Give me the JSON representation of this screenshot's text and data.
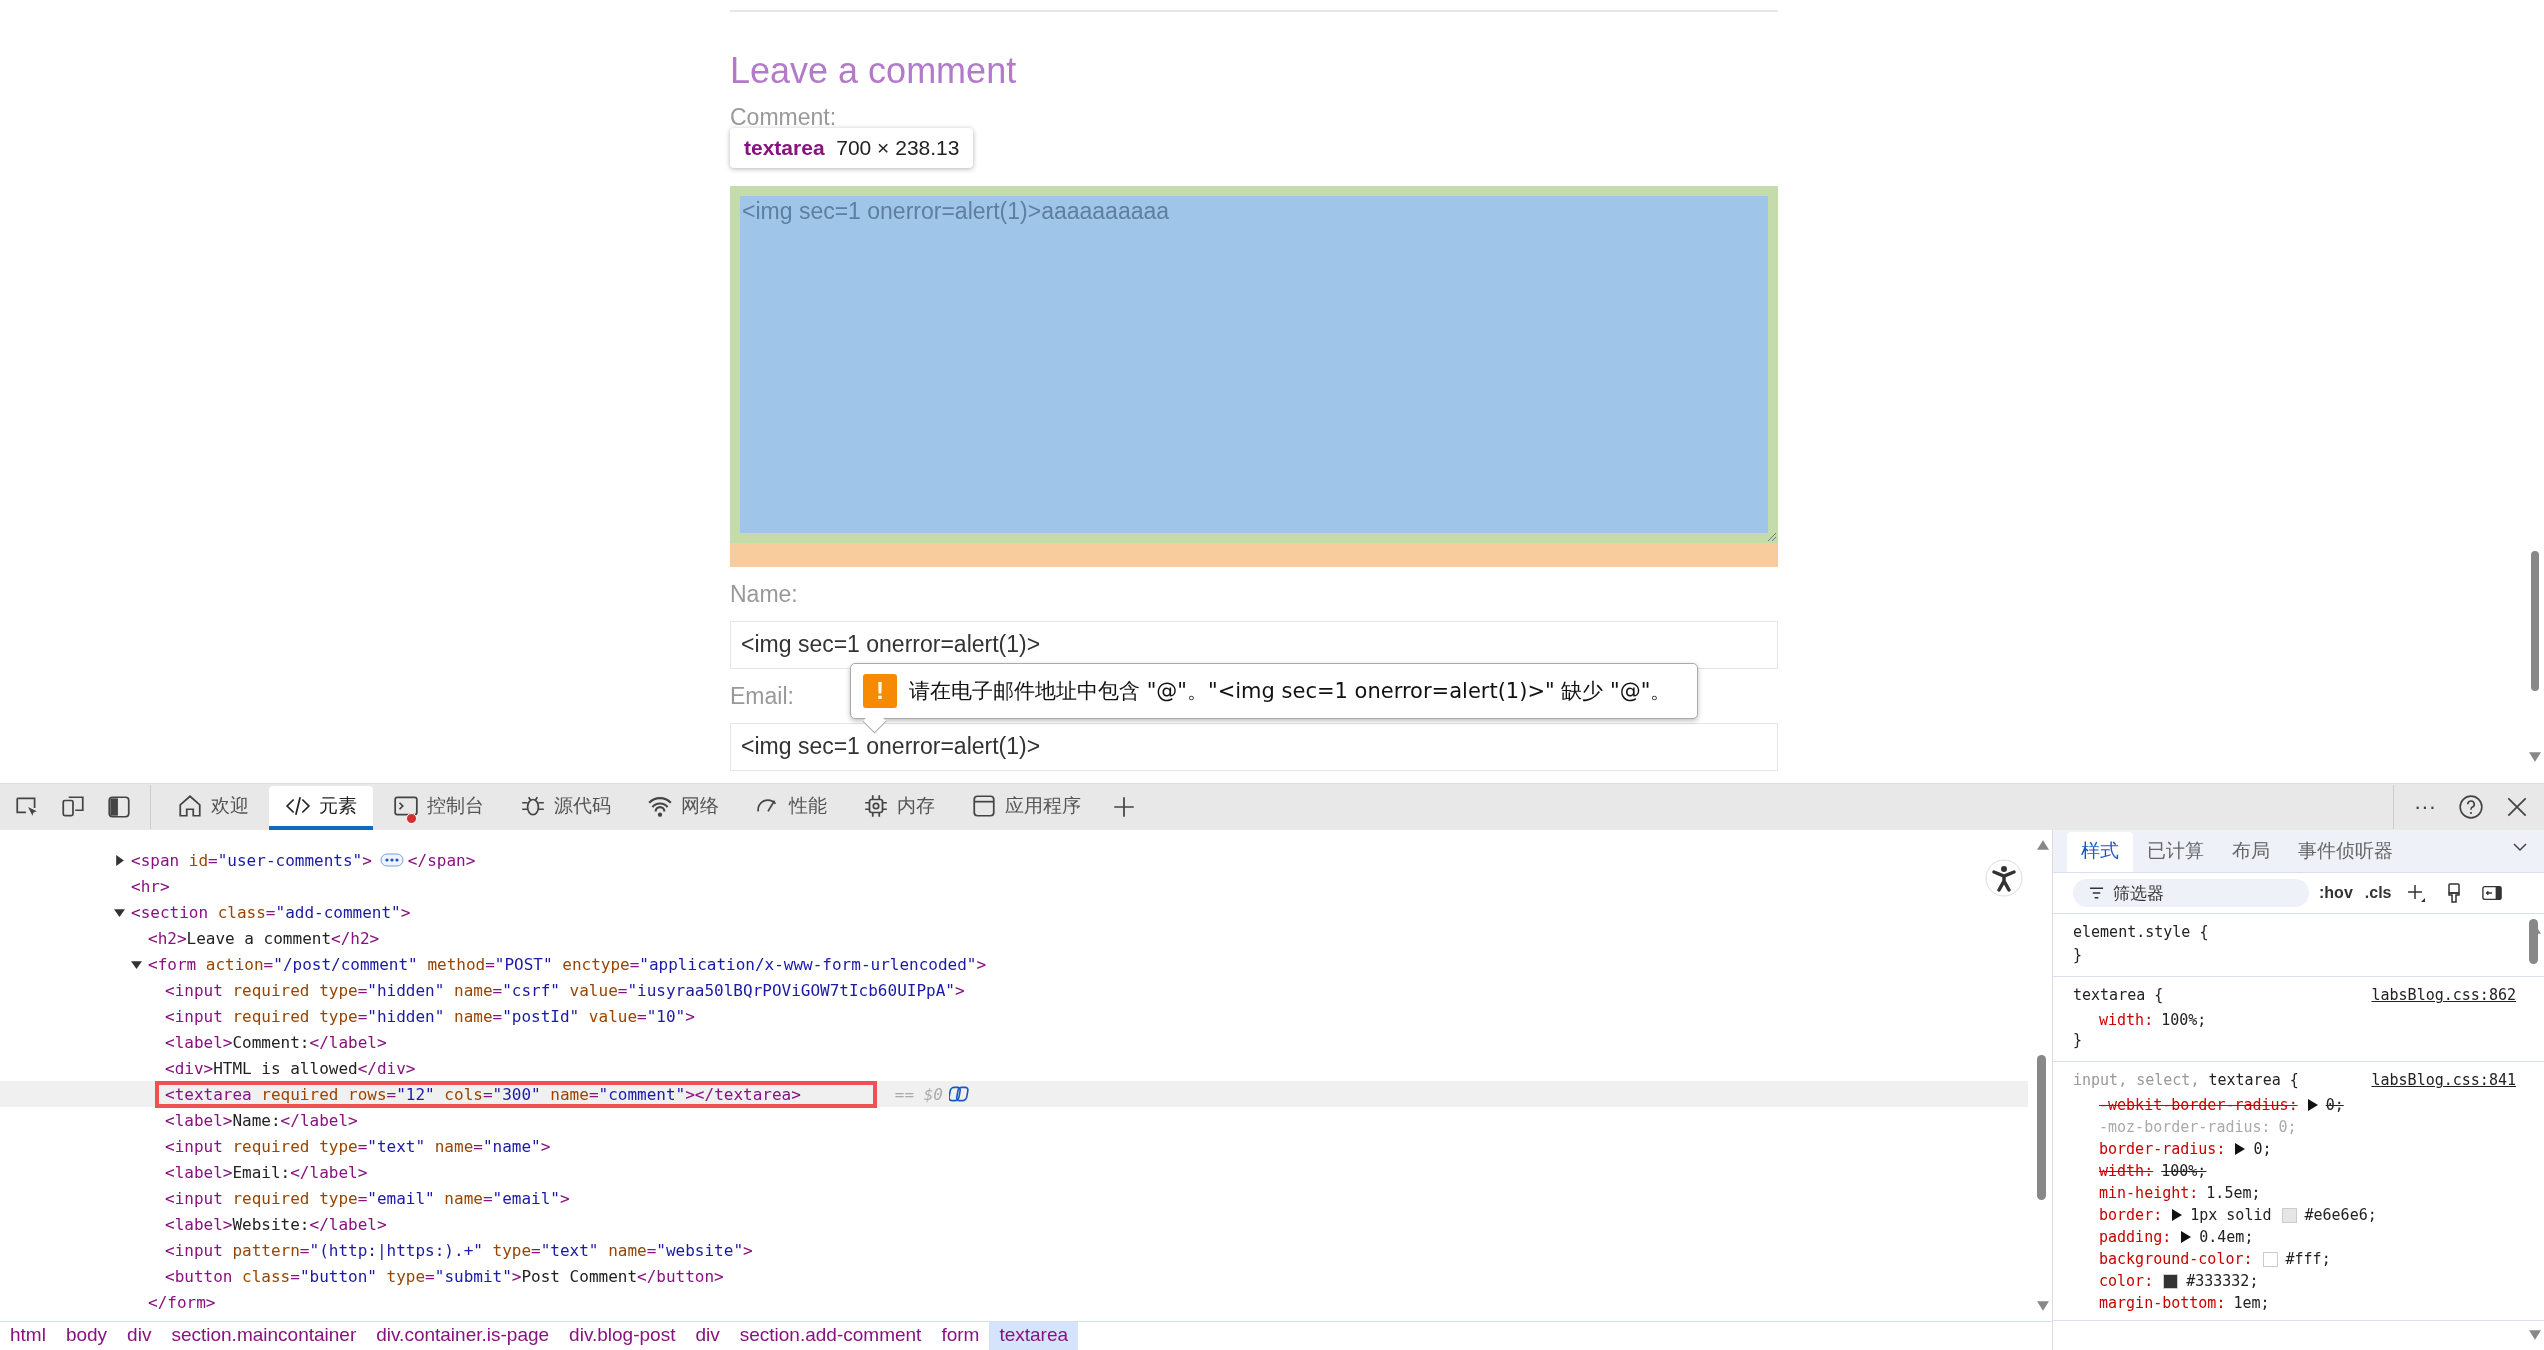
{
  "page": {
    "heading": "Leave a comment",
    "comment_label": "Comment:",
    "inspect_tooltip": {
      "tag": "textarea",
      "size": "700 × 238.13"
    },
    "comment_value": "<img sec=1 onerror=alert(1)>aaaaaaaaaa",
    "fields": [
      {
        "label": "Name:",
        "value": "<img sec=1 onerror=alert(1)>"
      },
      {
        "label": "Email:",
        "value": "<img sec=1 onerror=alert(1)>"
      }
    ],
    "validation": {
      "icon": "!",
      "message": "请在电子邮件地址中包含 \"@\"。\"<img sec=1 onerror=alert(1)>\" 缺少 \"@\"。"
    }
  },
  "devtools": {
    "tabs": [
      {
        "label": "欢迎",
        "selected": false
      },
      {
        "label": "元素",
        "selected": true
      },
      {
        "label": "控制台",
        "selected": false,
        "has_errors": true
      },
      {
        "label": "源代码",
        "selected": false
      },
      {
        "label": "网络",
        "selected": false
      },
      {
        "label": "性能",
        "selected": false
      },
      {
        "label": "内存",
        "selected": false
      },
      {
        "label": "应用程序",
        "selected": false
      }
    ],
    "more_icon": "···",
    "nodes": [
      {
        "selected": false,
        "expanded": false,
        "tokens": [
          {
            "kind": "tag",
            "s": "<span"
          },
          {
            "kind": "attr",
            "s": " id"
          },
          {
            "kind": "tag",
            "s": "="
          },
          {
            "kind": "value",
            "s": "\"user-comments\""
          },
          {
            "kind": "tag",
            "s": ">"
          }
        ],
        "tail": [
          {
            "kind": "tag",
            "s": "</span>"
          }
        ]
      },
      {
        "selected": false,
        "tokens": [
          {
            "kind": "tag",
            "s": "<hr>"
          }
        ]
      },
      {
        "selected": false,
        "expanded": true,
        "tokens": [
          {
            "kind": "tag",
            "s": "<section"
          },
          {
            "kind": "attr",
            "s": " class"
          },
          {
            "kind": "tag",
            "s": "="
          },
          {
            "kind": "value",
            "s": "\"add-comment\""
          },
          {
            "kind": "tag",
            "s": ">"
          }
        ],
        "children": [
          {
            "selected": false,
            "tokens": [
              {
                "kind": "tag",
                "s": "<h2>"
              },
              {
                "kind": "text",
                "s": "Leave a comment"
              },
              {
                "kind": "tag",
                "s": "</h2>"
              }
            ]
          },
          {
            "selected": false,
            "expanded": true,
            "tokens": [
              {
                "kind": "tag",
                "s": "<form"
              },
              {
                "kind": "attr",
                "s": " action"
              },
              {
                "kind": "tag",
                "s": "="
              },
              {
                "kind": "value",
                "s": "\"/post/comment\""
              },
              {
                "kind": "attr",
                "s": " method"
              },
              {
                "kind": "tag",
                "s": "="
              },
              {
                "kind": "value",
                "s": "\"POST\""
              },
              {
                "kind": "attr",
                "s": " enctype"
              },
              {
                "kind": "tag",
                "s": "="
              },
              {
                "kind": "value",
                "s": "\"application/x-www-form-urlencoded\""
              },
              {
                "kind": "tag",
                "s": ">"
              }
            ],
            "children": [
              {
                "selected": false,
                "tokens": [
                  {
                    "kind": "tag",
                    "s": "<input"
                  },
                  {
                    "kind": "attr",
                    "s": " required type"
                  },
                  {
                    "kind": "tag",
                    "s": "="
                  },
                  {
                    "kind": "value",
                    "s": "\"hidden\""
                  },
                  {
                    "kind": "attr",
                    "s": " name"
                  },
                  {
                    "kind": "tag",
                    "s": "="
                  },
                  {
                    "kind": "value",
                    "s": "\"csrf\""
                  },
                  {
                    "kind": "attr",
                    "s": " value"
                  },
                  {
                    "kind": "tag",
                    "s": "="
                  },
                  {
                    "kind": "value",
                    "s": "\"iusyraa50lBQrPOViGOW7tIcb60UIPpA\""
                  },
                  {
                    "kind": "tag",
                    "s": ">"
                  }
                ]
              },
              {
                "selected": false,
                "tokens": [
                  {
                    "kind": "tag",
                    "s": "<input"
                  },
                  {
                    "kind": "attr",
                    "s": " required type"
                  },
                  {
                    "kind": "tag",
                    "s": "="
                  },
                  {
                    "kind": "value",
                    "s": "\"hidden\""
                  },
                  {
                    "kind": "attr",
                    "s": " name"
                  },
                  {
                    "kind": "tag",
                    "s": "="
                  },
                  {
                    "kind": "value",
                    "s": "\"postId\""
                  },
                  {
                    "kind": "attr",
                    "s": " value"
                  },
                  {
                    "kind": "tag",
                    "s": "="
                  },
                  {
                    "kind": "value",
                    "s": "\"10\""
                  },
                  {
                    "kind": "tag",
                    "s": ">"
                  }
                ]
              },
              {
                "selected": false,
                "tokens": [
                  {
                    "kind": "tag",
                    "s": "<label>"
                  },
                  {
                    "kind": "text",
                    "s": "Comment:"
                  },
                  {
                    "kind": "tag",
                    "s": "</label>"
                  }
                ]
              },
              {
                "selected": false,
                "tokens": [
                  {
                    "kind": "tag",
                    "s": "<div>"
                  },
                  {
                    "kind": "text",
                    "s": "HTML is allowed"
                  },
                  {
                    "kind": "tag",
                    "s": "</div>"
                  }
                ]
              },
              {
                "selected": true,
                "marker": "== $0",
                "tokens": [
                  {
                    "kind": "tag",
                    "s": "<textarea"
                  },
                  {
                    "kind": "attr",
                    "s": " required rows"
                  },
                  {
                    "kind": "tag",
                    "s": "="
                  },
                  {
                    "kind": "value",
                    "s": "\"12\""
                  },
                  {
                    "kind": "attr",
                    "s": " cols"
                  },
                  {
                    "kind": "tag",
                    "s": "="
                  },
                  {
                    "kind": "value",
                    "s": "\"300\""
                  },
                  {
                    "kind": "attr",
                    "s": " name"
                  },
                  {
                    "kind": "tag",
                    "s": "="
                  },
                  {
                    "kind": "value",
                    "s": "\"comment\""
                  },
                  {
                    "kind": "tag",
                    "s": "></textarea>"
                  }
                ]
              },
              {
                "selected": false,
                "tokens": [
                  {
                    "kind": "tag",
                    "s": "<label>"
                  },
                  {
                    "kind": "text",
                    "s": "Name:"
                  },
                  {
                    "kind": "tag",
                    "s": "</label>"
                  }
                ]
              },
              {
                "selected": false,
                "tokens": [
                  {
                    "kind": "tag",
                    "s": "<input"
                  },
                  {
                    "kind": "attr",
                    "s": " required type"
                  },
                  {
                    "kind": "tag",
                    "s": "="
                  },
                  {
                    "kind": "value",
                    "s": "\"text\""
                  },
                  {
                    "kind": "attr",
                    "s": " name"
                  },
                  {
                    "kind": "tag",
                    "s": "="
                  },
                  {
                    "kind": "value",
                    "s": "\"name\""
                  },
                  {
                    "kind": "tag",
                    "s": ">"
                  }
                ]
              },
              {
                "selected": false,
                "tokens": [
                  {
                    "kind": "tag",
                    "s": "<label>"
                  },
                  {
                    "kind": "text",
                    "s": "Email:"
                  },
                  {
                    "kind": "tag",
                    "s": "</label>"
                  }
                ]
              },
              {
                "selected": false,
                "tokens": [
                  {
                    "kind": "tag",
                    "s": "<input"
                  },
                  {
                    "kind": "attr",
                    "s": " required type"
                  },
                  {
                    "kind": "tag",
                    "s": "="
                  },
                  {
                    "kind": "value",
                    "s": "\"email\""
                  },
                  {
                    "kind": "attr",
                    "s": " name"
                  },
                  {
                    "kind": "tag",
                    "s": "="
                  },
                  {
                    "kind": "value",
                    "s": "\"email\""
                  },
                  {
                    "kind": "tag",
                    "s": ">"
                  }
                ]
              },
              {
                "selected": false,
                "tokens": [
                  {
                    "kind": "tag",
                    "s": "<label>"
                  },
                  {
                    "kind": "text",
                    "s": "Website:"
                  },
                  {
                    "kind": "tag",
                    "s": "</label>"
                  }
                ]
              },
              {
                "selected": false,
                "tokens": [
                  {
                    "kind": "tag",
                    "s": "<input"
                  },
                  {
                    "kind": "attr",
                    "s": " pattern"
                  },
                  {
                    "kind": "tag",
                    "s": "="
                  },
                  {
                    "kind": "value",
                    "s": "\"(http:|https:).+\""
                  },
                  {
                    "kind": "attr",
                    "s": " type"
                  },
                  {
                    "kind": "tag",
                    "s": "="
                  },
                  {
                    "kind": "value",
                    "s": "\"text\""
                  },
                  {
                    "kind": "attr",
                    "s": " name"
                  },
                  {
                    "kind": "tag",
                    "s": "="
                  },
                  {
                    "kind": "value",
                    "s": "\"website\""
                  },
                  {
                    "kind": "tag",
                    "s": ">"
                  }
                ]
              },
              {
                "selected": false,
                "tokens": [
                  {
                    "kind": "tag",
                    "s": "<button"
                  },
                  {
                    "kind": "attr",
                    "s": " class"
                  },
                  {
                    "kind": "tag",
                    "s": "="
                  },
                  {
                    "kind": "value",
                    "s": "\"button\""
                  },
                  {
                    "kind": "attr",
                    "s": " type"
                  },
                  {
                    "kind": "tag",
                    "s": "="
                  },
                  {
                    "kind": "value",
                    "s": "\"submit\""
                  },
                  {
                    "kind": "tag",
                    "s": ">"
                  },
                  {
                    "kind": "text",
                    "s": "Post Comment"
                  },
                  {
                    "kind": "tag",
                    "s": "</button>"
                  }
                ]
              }
            ]
          },
          {
            "selected": false,
            "tokens": [
              {
                "kind": "tag",
                "s": "</form>"
              }
            ]
          }
        ]
      }
    ],
    "breadcrumbs": [
      {
        "label": "html",
        "selected": false
      },
      {
        "label": "body",
        "selected": false
      },
      {
        "label": "div",
        "selected": false
      },
      {
        "label": "section.maincontainer",
        "selected": false
      },
      {
        "label": "div.container.is-page",
        "selected": false
      },
      {
        "label": "div.blog-post",
        "selected": false
      },
      {
        "label": "div",
        "selected": false
      },
      {
        "label": "section.add-comment",
        "selected": false
      },
      {
        "label": "form",
        "selected": false
      },
      {
        "label": "textarea",
        "selected": true
      }
    ],
    "style_tabs": [
      {
        "label": "样式",
        "selected": true
      },
      {
        "label": "已计算",
        "selected": false
      },
      {
        "label": "布局",
        "selected": false
      },
      {
        "label": "事件侦听器",
        "selected": false
      }
    ],
    "filter": {
      "placeholder": "筛选器"
    },
    "style_buttons": [
      ":hov",
      ".cls"
    ],
    "rules": [
      {
        "selector": [
          {
            "s": "element.style {",
            "matched": true
          }
        ],
        "close": "}"
      },
      {
        "selector": [
          {
            "s": "textarea {",
            "matched": true
          }
        ],
        "source": "labsBlog.css:862",
        "close": "}",
        "declarations": [
          {
            "prop": "width:",
            "value": "100%;",
            "overridden": false,
            "inactive": false,
            "arrow": false
          }
        ]
      },
      {
        "selector": [
          {
            "s": "input, ",
            "matched": false
          },
          {
            "s": "select, ",
            "matched": false
          },
          {
            "s": "textarea {",
            "matched": true
          }
        ],
        "source": "labsBlog.css:841",
        "declarations": [
          {
            "prop": "-webkit-border-radius:",
            "value": "0;",
            "overridden": true,
            "inactive": false,
            "arrow": true
          },
          {
            "prop": "-moz-border-radius:",
            "value": "0;",
            "overridden": false,
            "inactive": true,
            "arrow": false
          },
          {
            "prop": "border-radius:",
            "value": "0;",
            "overridden": false,
            "inactive": false,
            "arrow": true
          },
          {
            "prop": "width:",
            "value": "100%;",
            "overridden": true,
            "inactive": false,
            "arrow": false
          },
          {
            "prop": "min-height:",
            "value": "1.5em;",
            "overridden": false,
            "inactive": false,
            "arrow": false
          },
          {
            "prop": "border:",
            "value": "1px solid",
            "swatch": "#e6e6e6",
            "end": ";",
            "overridden": false,
            "inactive": false,
            "arrow": true
          },
          {
            "prop": "padding:",
            "value": "0.4em;",
            "overridden": false,
            "inactive": false,
            "arrow": true
          },
          {
            "prop": "background-color:",
            "swatch": "#fff",
            "end": ";",
            "overridden": false,
            "inactive": false,
            "arrow": false
          },
          {
            "prop": "color:",
            "swatch": "#333332",
            "end": ";",
            "overridden": false,
            "inactive": false,
            "arrow": false
          },
          {
            "prop": "margin-bottom:",
            "value": "1em;",
            "overridden": false,
            "inactive": false,
            "arrow": false
          }
        ]
      }
    ]
  }
}
